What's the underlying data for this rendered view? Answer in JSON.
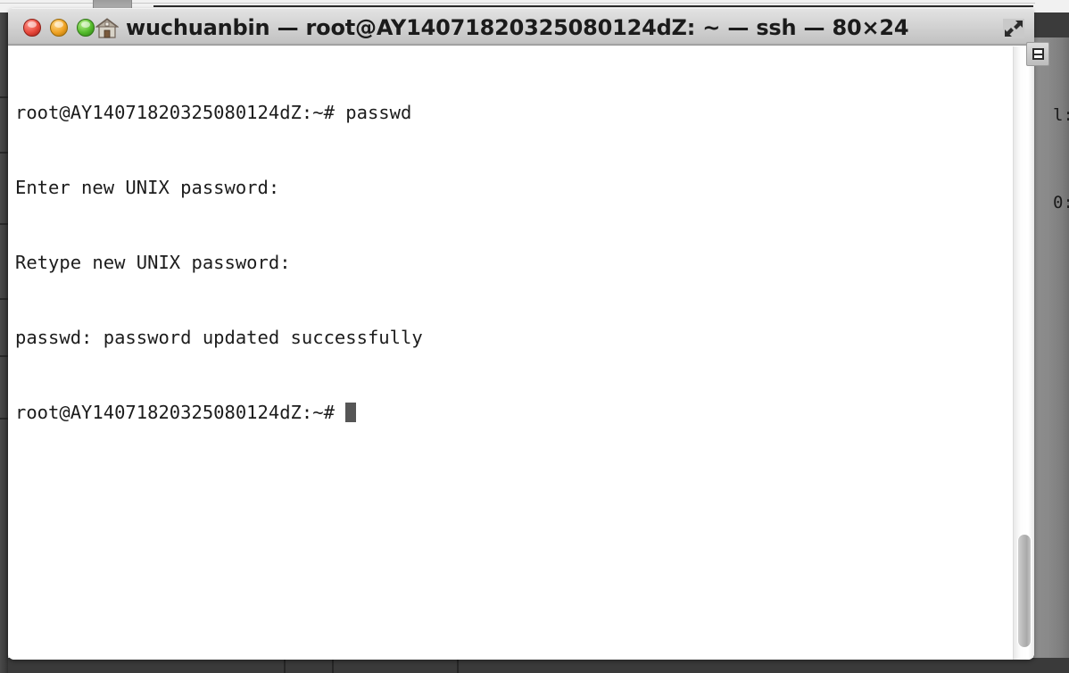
{
  "window": {
    "title": "wuchuanbin — root@AY14071820325080124dZ: ~ — ssh — 80×24",
    "titlebar_buttons": {
      "close_label": "close",
      "minimize_label": "minimize",
      "zoom_label": "zoom"
    },
    "home_icon_name": "home-icon",
    "fullscreen_icon_name": "fullscreen-icon",
    "dimensions_label": "80×24",
    "session_label": "ssh"
  },
  "terminal": {
    "prompt": "root@AY14071820325080124dZ:~#",
    "lines": [
      "root@AY14071820325080124dZ:~# passwd",
      "Enter new UNIX password:",
      "Retype new UNIX password:",
      "passwd: password updated successfully",
      "root@AY14071820325080124dZ:~# "
    ],
    "cursor_visible": true,
    "foreground_color": "#1c1c1c",
    "background_color": "#ffffff",
    "cursor_color": "#565656"
  },
  "scrollbar": {
    "thumb_position_label": "bottom",
    "widget_icon_name": "scroll-widget-icon"
  },
  "backdrop": {
    "fragments": [
      "l:",
      "0:"
    ],
    "desktop_color": "#8a8a8a",
    "dock_color": "#3e3e3e"
  }
}
